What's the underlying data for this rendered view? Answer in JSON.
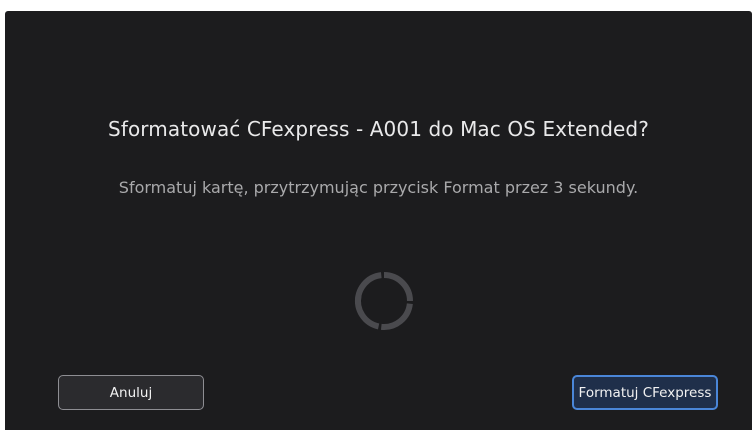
{
  "dialog": {
    "title": "Sformatować CFexpress - A001 do Mac OS Extended?",
    "message": "Sformatuj kartę, przytrzymując przycisk Format przez 3 sekundy."
  },
  "progress_indicator": {
    "icon": "loading-spinner-icon",
    "segments": 4
  },
  "buttons": {
    "cancel_label": "Anuluj",
    "format_label": "Formatuj CFexpress"
  },
  "colors": {
    "background": "#1c1c1e",
    "title_text": "#e9e9ea",
    "message_text": "#a9a9ab",
    "cancel_border": "#8e8e93",
    "accent_border": "#4a86d8",
    "accent_fill": "#1f2f4a",
    "spinner": "#4a4a4e"
  }
}
